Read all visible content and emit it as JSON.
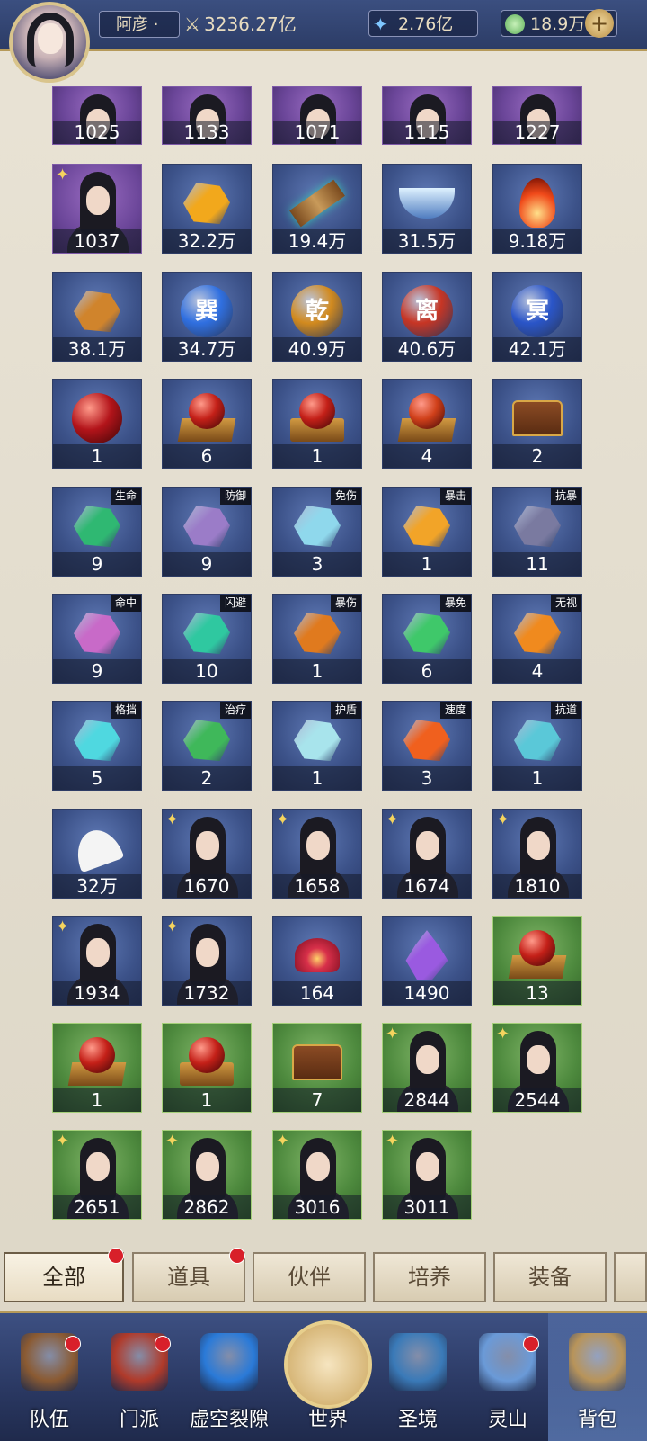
{
  "header": {
    "player_name": "阿彦 ·",
    "combat_power": "3236.27亿",
    "currency_1": "2.76亿",
    "currency_2": "18.9万",
    "add_label": "+"
  },
  "items": [
    {
      "count": "1025",
      "frame": "purple",
      "kind": "portrait"
    },
    {
      "count": "1133",
      "frame": "purple",
      "kind": "portrait"
    },
    {
      "count": "1071",
      "frame": "purple",
      "kind": "portrait"
    },
    {
      "count": "1115",
      "frame": "purple",
      "kind": "portrait"
    },
    {
      "count": "1227",
      "frame": "purple",
      "kind": "portrait"
    },
    {
      "count": "1037",
      "frame": "purple",
      "kind": "portrait",
      "star": true
    },
    {
      "count": "32.2万",
      "frame": "blue",
      "kind": "gem",
      "color": "#f2a81c"
    },
    {
      "count": "19.4万",
      "frame": "blue",
      "kind": "scroll",
      "color": "#38c0b0"
    },
    {
      "count": "31.5万",
      "frame": "blue",
      "kind": "bowl",
      "color": "#9ad0f0"
    },
    {
      "count": "9.18万",
      "frame": "blue",
      "kind": "flame",
      "color": "#f04a1a"
    },
    {
      "count": "38.1万",
      "frame": "blue",
      "kind": "gem",
      "color": "#d0842c"
    },
    {
      "count": "34.7万",
      "frame": "blue",
      "kind": "rune",
      "rune": "巽",
      "color": "#2f6fe0"
    },
    {
      "count": "40.9万",
      "frame": "blue",
      "kind": "rune",
      "rune": "乾",
      "color": "#d28a1e"
    },
    {
      "count": "40.6万",
      "frame": "blue",
      "kind": "rune",
      "rune": "离",
      "color": "#c73524"
    },
    {
      "count": "42.1万",
      "frame": "blue",
      "kind": "rune",
      "rune": "冥",
      "color": "#2a55c8"
    },
    {
      "count": "1",
      "frame": "blue",
      "kind": "orb",
      "color": "#b3141a"
    },
    {
      "count": "6",
      "frame": "blue",
      "kind": "orbplate",
      "color": "#c42018"
    },
    {
      "count": "1",
      "frame": "blue",
      "kind": "orbbox",
      "color": "#c42018"
    },
    {
      "count": "4",
      "frame": "blue",
      "kind": "orbplate",
      "color": "#d0401a"
    },
    {
      "count": "2",
      "frame": "blue",
      "kind": "chest",
      "color": "#c42018"
    },
    {
      "count": "9",
      "frame": "blue",
      "kind": "gem",
      "color": "#2fb872",
      "tag": "生命"
    },
    {
      "count": "9",
      "frame": "blue",
      "kind": "gem",
      "color": "#9b7cc8",
      "tag": "防御"
    },
    {
      "count": "3",
      "frame": "blue",
      "kind": "gem",
      "color": "#8fd8ec",
      "tag": "免伤"
    },
    {
      "count": "1",
      "frame": "blue",
      "kind": "gem",
      "color": "#f2a428",
      "tag": "暴击"
    },
    {
      "count": "11",
      "frame": "blue",
      "kind": "gem",
      "color": "#7a7aa0",
      "tag": "抗暴"
    },
    {
      "count": "9",
      "frame": "blue",
      "kind": "gem",
      "color": "#c86ac8",
      "tag": "命中"
    },
    {
      "count": "10",
      "frame": "blue",
      "kind": "gem",
      "color": "#2fc8a0",
      "tag": "闪避"
    },
    {
      "count": "1",
      "frame": "blue",
      "kind": "gem",
      "color": "#e07a1e",
      "tag": "暴伤"
    },
    {
      "count": "6",
      "frame": "blue",
      "kind": "gem",
      "color": "#3fc86a",
      "tag": "暴免"
    },
    {
      "count": "4",
      "frame": "blue",
      "kind": "gem",
      "color": "#f08a1e",
      "tag": "无视"
    },
    {
      "count": "5",
      "frame": "blue",
      "kind": "gem",
      "color": "#4fd8e0",
      "tag": "格挡"
    },
    {
      "count": "2",
      "frame": "blue",
      "kind": "gem",
      "color": "#3fb85a",
      "tag": "治疗"
    },
    {
      "count": "1",
      "frame": "blue",
      "kind": "gem",
      "color": "#a8e4ec",
      "tag": "护盾"
    },
    {
      "count": "3",
      "frame": "blue",
      "kind": "gem",
      "color": "#f0601e",
      "tag": "速度"
    },
    {
      "count": "1",
      "frame": "blue",
      "kind": "gem",
      "color": "#5ac8d8",
      "tag": "抗道"
    },
    {
      "count": "32万",
      "frame": "blue",
      "kind": "leaf",
      "color": "#f4f4f4"
    },
    {
      "count": "1670",
      "frame": "blue",
      "kind": "portrait",
      "star": true
    },
    {
      "count": "1658",
      "frame": "blue",
      "kind": "portrait",
      "star": true
    },
    {
      "count": "1674",
      "frame": "blue",
      "kind": "portrait",
      "star": true
    },
    {
      "count": "1810",
      "frame": "blue",
      "kind": "portrait",
      "star": true
    },
    {
      "count": "1934",
      "frame": "blue",
      "kind": "portrait",
      "star": true
    },
    {
      "count": "1732",
      "frame": "blue",
      "kind": "portrait",
      "star": true
    },
    {
      "count": "164",
      "frame": "blue",
      "kind": "flower",
      "color": "#d8304a"
    },
    {
      "count": "1490",
      "frame": "blue",
      "kind": "crystal",
      "color": "#9a5ae0"
    },
    {
      "count": "13",
      "frame": "green",
      "kind": "orbplate",
      "color": "#c42018"
    },
    {
      "count": "1",
      "frame": "green",
      "kind": "orbplate",
      "color": "#c42018"
    },
    {
      "count": "1",
      "frame": "green",
      "kind": "orbbox",
      "color": "#c42018"
    },
    {
      "count": "7",
      "frame": "green",
      "kind": "chest",
      "color": "#c42018"
    },
    {
      "count": "2844",
      "frame": "green",
      "kind": "portrait",
      "star": true
    },
    {
      "count": "2544",
      "frame": "green",
      "kind": "portrait",
      "star": true
    },
    {
      "count": "2651",
      "frame": "green",
      "kind": "portrait",
      "star": true
    },
    {
      "count": "2862",
      "frame": "green",
      "kind": "portrait",
      "star": true
    },
    {
      "count": "3016",
      "frame": "green",
      "kind": "portrait",
      "star": true
    },
    {
      "count": "3011",
      "frame": "green",
      "kind": "portrait",
      "star": true
    }
  ],
  "tabs": [
    {
      "label": "全部",
      "active": true,
      "dot": true
    },
    {
      "label": "道具",
      "active": false,
      "dot": true
    },
    {
      "label": "伙伴",
      "active": false,
      "dot": false
    },
    {
      "label": "培养",
      "active": false,
      "dot": false
    },
    {
      "label": "装备",
      "active": false,
      "dot": false
    }
  ],
  "nav": [
    {
      "label": "队伍",
      "icon": "team-icon",
      "dot": true
    },
    {
      "label": "门派",
      "icon": "sect-icon",
      "dot": true
    },
    {
      "label": "虚空裂隙",
      "icon": "rift-icon",
      "dot": false
    },
    {
      "label": "世界",
      "icon": "world-icon",
      "dot": false
    },
    {
      "label": "圣境",
      "icon": "sanctum-icon",
      "dot": false
    },
    {
      "label": "灵山",
      "icon": "mountain-icon",
      "dot": true
    },
    {
      "label": "背包",
      "icon": "backpack-icon",
      "dot": false,
      "selected": true
    }
  ]
}
